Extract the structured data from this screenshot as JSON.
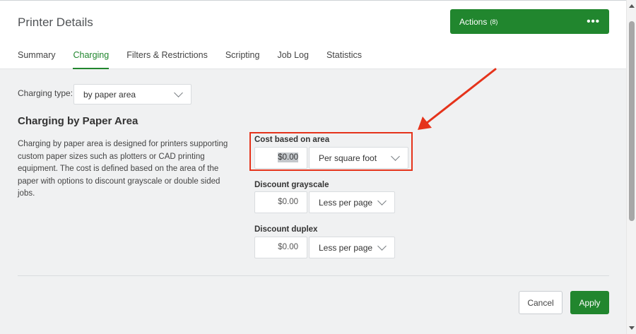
{
  "header": {
    "title": "Printer Details",
    "actions_label": "Actions",
    "actions_count": "(8)",
    "more_glyph": "•••"
  },
  "tabs": [
    {
      "label": "Summary",
      "active": false
    },
    {
      "label": "Charging",
      "active": true
    },
    {
      "label": "Filters & Restrictions",
      "active": false
    },
    {
      "label": "Scripting",
      "active": false
    },
    {
      "label": "Job Log",
      "active": false
    },
    {
      "label": "Statistics",
      "active": false
    }
  ],
  "charging": {
    "type_label": "Charging type:",
    "type_value": "by paper area",
    "section_title": "Charging by Paper Area",
    "description": "Charging by paper area is designed for printers supporting custom paper sizes such as plotters or CAD printing equipment. The cost is defined based on the area of the paper with options to discount grayscale or double sided jobs.",
    "cost": {
      "label": "Cost based on area",
      "value": "$0.00",
      "unit": "Per square foot"
    },
    "grayscale": {
      "label": "Discount grayscale",
      "value": "$0.00",
      "mode": "Less per page"
    },
    "duplex": {
      "label": "Discount duplex",
      "value": "$0.00",
      "mode": "Less per page"
    }
  },
  "footer": {
    "cancel_label": "Cancel",
    "apply_label": "Apply"
  },
  "colors": {
    "accent": "#21862e",
    "annotation": "#e5331b",
    "content_bg": "#f0f1f2"
  }
}
